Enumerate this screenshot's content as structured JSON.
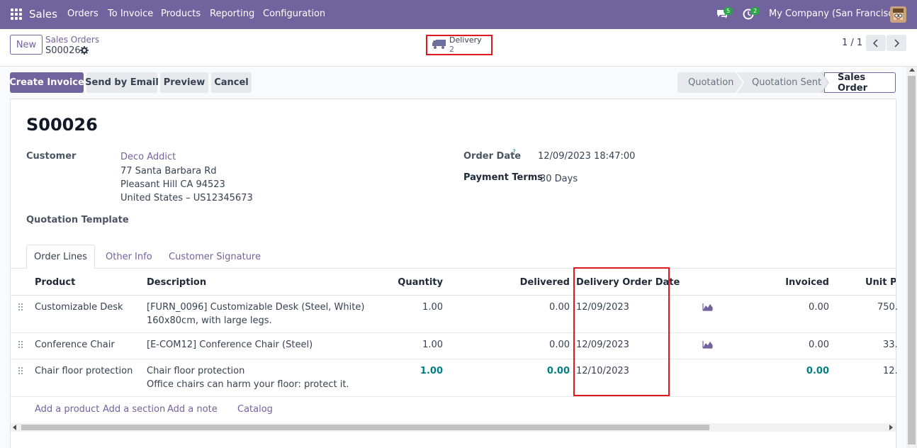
{
  "nav": {
    "app": "Sales",
    "menu": [
      "Orders",
      "To Invoice",
      "Products",
      "Reporting",
      "Configuration"
    ],
    "messages_count": "5",
    "activity_count": "2",
    "company": "My Company (San Francisco)"
  },
  "control": {
    "new_label": "New",
    "breadcrumb_parent": "Sales Orders",
    "breadcrumb_current": "S00026",
    "smart_button": {
      "label": "Delivery",
      "count": "2"
    },
    "pager": "1 / 1"
  },
  "actions": {
    "create_invoice": "Create Invoice",
    "send_email": "Send by Email",
    "preview": "Preview",
    "cancel": "Cancel"
  },
  "statusbar": {
    "stages": [
      "Quotation",
      "Quotation Sent",
      "Sales Order"
    ],
    "active": "Sales Order"
  },
  "form": {
    "title": "S00026",
    "customer_label": "Customer",
    "customer_name": "Deco Addict",
    "address": [
      "77 Santa Barbara Rd",
      "Pleasant Hill CA 94523",
      "United States – US12345673"
    ],
    "quotation_template_label": "Quotation Template",
    "order_date_label": "Order Date",
    "order_date_help": "?",
    "order_date": "12/09/2023 18:47:00",
    "payment_terms_label": "Payment Terms",
    "payment_terms": "30 Days"
  },
  "tabs": [
    "Order Lines",
    "Other Info",
    "Customer Signature"
  ],
  "table": {
    "headers": {
      "product": "Product",
      "description": "Description",
      "quantity": "Quantity",
      "delivered": "Delivered",
      "delivery_date": "Delivery Order Date",
      "invoiced": "Invoiced",
      "unit_price": "Unit Pri"
    },
    "rows": [
      {
        "product": "Customizable Desk",
        "desc1": "[FURN_0096] Customizable Desk (Steel, White)",
        "desc2": "160x80cm, with large legs.",
        "qty": "1.00",
        "delivered": "0.00",
        "date": "12/09/2023",
        "invoiced": "0.00",
        "price": "750."
      },
      {
        "product": "Conference Chair",
        "desc1": "[E-COM12] Conference Chair (Steel)",
        "desc2": "",
        "qty": "1.00",
        "delivered": "0.00",
        "date": "12/09/2023",
        "invoiced": "0.00",
        "price": "33."
      },
      {
        "product": "Chair floor protection",
        "desc1": "Chair floor protection",
        "desc2": "Office chairs can harm your floor: protect it.",
        "qty": "1.00",
        "delivered": "0.00",
        "date": "12/10/2023",
        "invoiced": "0.00",
        "price": "12."
      }
    ],
    "add_product": "Add a product",
    "add_section": "Add a section",
    "add_note": "Add a note",
    "catalog": "Catalog"
  },
  "colors": {
    "brand": "#71639e",
    "highlight": "#e0181f",
    "accent_teal": "#017e84",
    "badge_green": "#28a745"
  }
}
